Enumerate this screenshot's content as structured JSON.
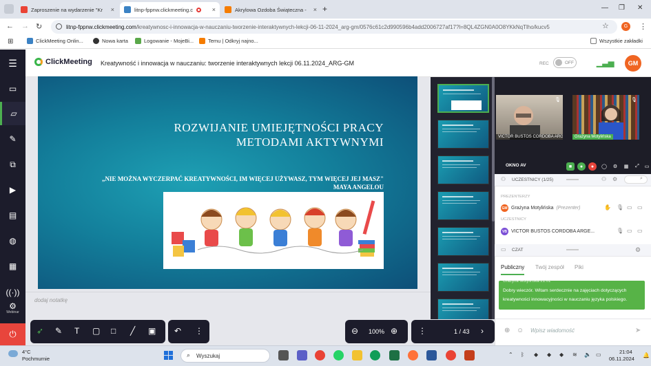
{
  "browser": {
    "tabs": [
      {
        "label": "Zaproszenie na wydarzenie \"Kr",
        "favicon": "gmail-icon",
        "active": false
      },
      {
        "label": "litnp-fppnw.clickmeeting.c",
        "favicon": "clickmeeting-icon",
        "active": true
      },
      {
        "label": "Akrylowa Ozdoba Świąteczna -",
        "favicon": "temu-icon",
        "active": false
      }
    ],
    "new_tab": "+",
    "url_host": "litnp-fppnw.clickmeeting.com",
    "url_path": "/kreatywnosc-i-innowacja-w-nauczaniu-tworzenie-interaktywnych-lekcji-06-11-2024_arg-gm/0576c61c2d990596b4add2006727af17?l=8QL4ZGN0A0O8YKkNqTlho/kucv5",
    "profile_initial": "G",
    "bookmarks": [
      {
        "label": "",
        "icon": "apps-grid-icon"
      },
      {
        "label": "ClickMeeting Onlin...",
        "icon": "clickmeeting-icon"
      },
      {
        "label": "Nowa karta",
        "icon": "globe-icon"
      },
      {
        "label": "Logowanie - MojeBi...",
        "icon": "mojebi-icon"
      },
      {
        "label": "Temu | Odkryj najno...",
        "icon": "temu-icon"
      }
    ],
    "all_bookmarks": "Wszystkie zakładki"
  },
  "app": {
    "brand": "ClickMeeting",
    "event_title": "Kreatywność i innowacja w nauczaniu: tworzenie interaktywnych lekcji 06.11.2024_ARG-GM",
    "rec_label": "REC",
    "rec_toggle": "OFF",
    "user_initials": "GM",
    "accent": "#4caf50",
    "orange": "#f06522"
  },
  "sidebar": {
    "webinar_label": "Webinar"
  },
  "slide": {
    "title_line1": "ROZWIJANIE UMIEJĘTNOŚCI PRACY",
    "title_line2": "METODAMI AKTYWNYMI",
    "quote": "„NIE MOŻNA WYCZERPAĆ KREATYWNOŚCI, IM WIĘCEJ UŻYWASZ, TYM WIĘCEJ JEJ MASZ\"",
    "author": "MAYA ANGELOU"
  },
  "notes": {
    "placeholder": "dodaj notatkę"
  },
  "toolbar": {
    "zoom": "100%",
    "page": "1 / 43"
  },
  "cams": [
    {
      "name": "VICTOR BUSTOS CORDOBA ARG..."
    },
    {
      "name": "Grażyna Motylińska"
    }
  ],
  "panel": {
    "okno": "OKNO AV",
    "participants_title": "UCZESTNICY (1/25)",
    "presenters_label": "PREZENTERZY",
    "participants_label": "UCZESTNICY",
    "presenter": {
      "initials": "GM",
      "name": "Grażyna Motylińska",
      "role": "(Prezenter)",
      "color": "#f06522"
    },
    "participant": {
      "initials": "VB",
      "name": "VICTOR BUSTOS CORDOBA ARGE...",
      "color": "#7b4fd6"
    },
    "chat_title": "CZAT",
    "chat_tabs": [
      "Publiczny",
      "Twój zespół",
      "Piki"
    ],
    "message_author": "Grażyna Motylińska 21:01",
    "message": "Dobry wieczór. Witam serdecznie na zajęciach dotyczących kreatywności innowacyjności w nauczaniu języka polskiego.",
    "input_placeholder": "Wpisz wiadomość"
  },
  "taskbar": {
    "temp": "4°C",
    "weather": "Pochmurnie",
    "search": "Wyszukaj",
    "time": "21:04",
    "date": "06.11.2024"
  }
}
